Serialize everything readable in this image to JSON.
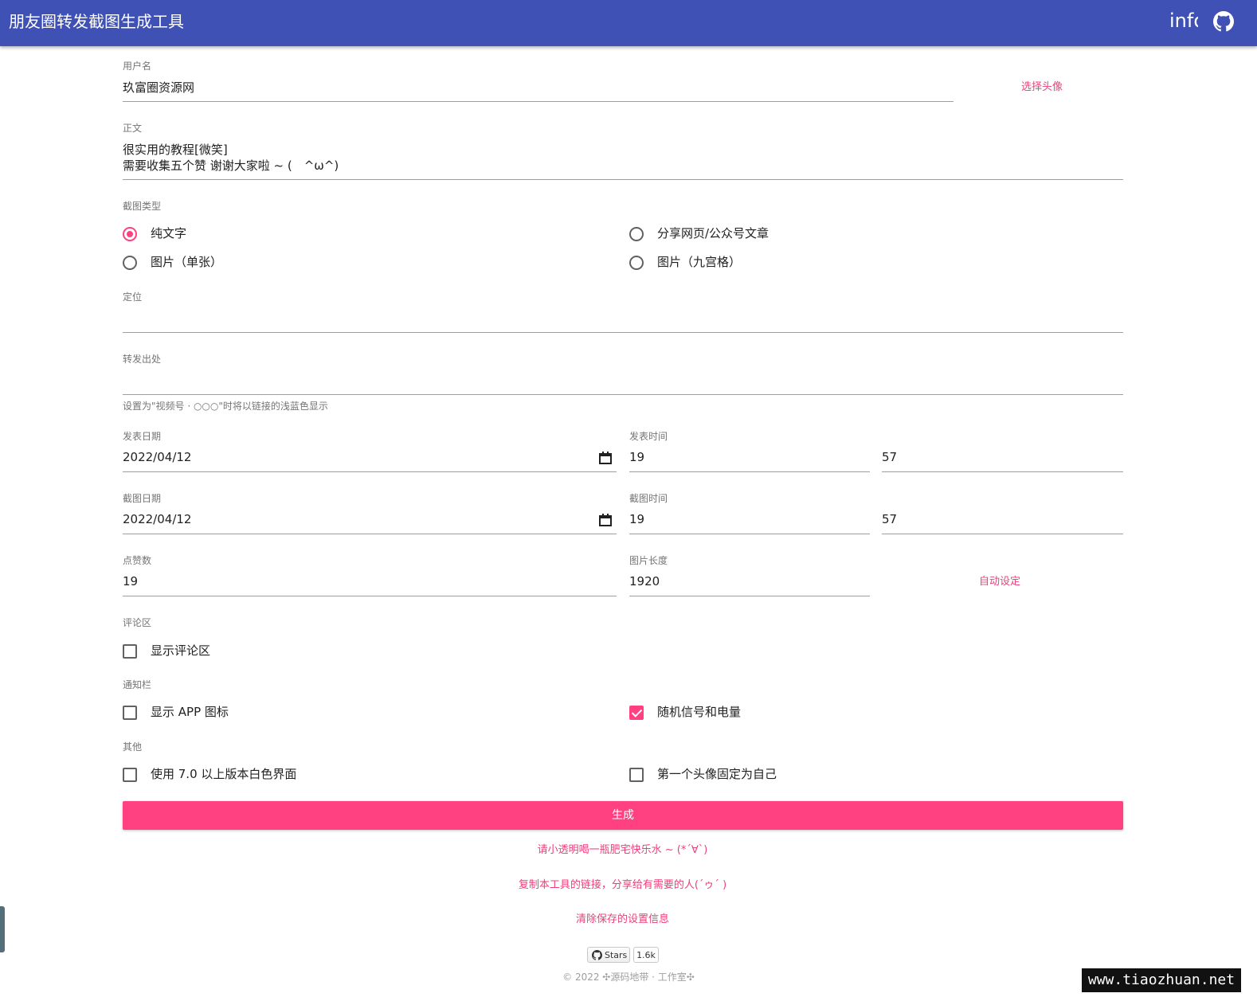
{
  "appbar": {
    "title": "朋友圈转发截图生成工具",
    "info_label": "info",
    "github_icon": "github-icon",
    "color": "#3f51b5"
  },
  "accent_color": "#ff4081",
  "username": {
    "label": "用户名",
    "value": "玖富圈资源网",
    "avatar_link": "选择头像"
  },
  "content": {
    "label": "正文",
    "line1": "很实用的教程[微笑]",
    "line2": "需要收集五个赞 谢谢大家啦 ~ (　^ω^)"
  },
  "type": {
    "label": "截图类型",
    "options": [
      {
        "label": "纯文字",
        "checked": true
      },
      {
        "label": "分享网页/公众号文章",
        "checked": false
      },
      {
        "label": "图片（单张）",
        "checked": false
      },
      {
        "label": "图片（九宫格）",
        "checked": false
      }
    ]
  },
  "location": {
    "label": "定位",
    "value": ""
  },
  "forward": {
    "label": "转发出处",
    "value": "",
    "hint": "设置为\"视频号 · ○○○\"时将以链接的浅蓝色显示"
  },
  "post": {
    "date_label": "发表日期",
    "date": "2022/04/12",
    "time_label": "发表时间",
    "hour": "19",
    "minute": "57"
  },
  "shot": {
    "date_label": "截图日期",
    "date": "2022/04/12",
    "time_label": "截图时间",
    "hour": "19",
    "minute": "57"
  },
  "likes": {
    "label": "点赞数",
    "value": "19"
  },
  "image_length": {
    "label": "图片长度",
    "value": "1920",
    "auto_link": "自动设定"
  },
  "comments": {
    "label": "评论区",
    "show_label": "显示评论区",
    "show_checked": false
  },
  "statusbar": {
    "label": "通知栏",
    "app_icon_label": "显示 APP 图标",
    "app_icon_checked": false,
    "random_label": "随机信号和电量",
    "random_checked": true
  },
  "other": {
    "label": "其他",
    "white_label": "使用 7.0 以上版本白色界面",
    "white_checked": false,
    "self_avatar_label": "第一个头像固定为自己",
    "self_avatar_checked": false
  },
  "generate_button": "生成",
  "links": {
    "donate": "请小透明喝一瓶肥宅快乐水 ~ (*´∀`)",
    "share": "复制本工具的链接，分享给有需要的人(´ゥ´ )",
    "clear": "清除保存的设置信息"
  },
  "github_badge": {
    "label": "Stars",
    "count": "1.6k"
  },
  "footer": "© 2022 ✣源码地带 · 工作室✣",
  "watermark": "www.tiaozhuan.net"
}
